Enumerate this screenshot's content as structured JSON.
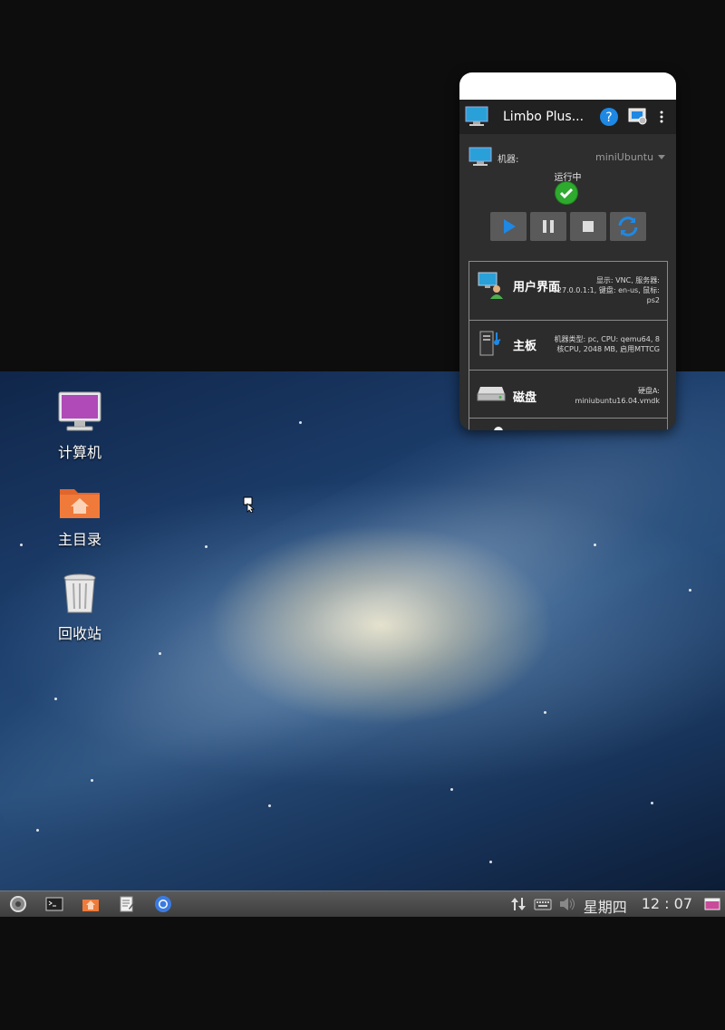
{
  "desktop": {
    "icons": [
      {
        "label": "计算机"
      },
      {
        "label": "主目录"
      },
      {
        "label": "回收站"
      }
    ]
  },
  "taskbar": {
    "weekday": "星期四",
    "time": "12 : 07"
  },
  "limbo": {
    "title": "Limbo Plus...",
    "machine_label": "机器:",
    "machine_value": "miniUbuntu",
    "status": "运行中",
    "cards": [
      {
        "title": "用户界面",
        "desc": "显示: VNC, 服务器: 127.0.0.1:1, 键盘: en-us, 鼠标: ps2"
      },
      {
        "title": "主板",
        "desc": "机器类型: pc, CPU: qemu64, 8 核CPU, 2048 MB, 启用MTTCG"
      },
      {
        "title": "磁盘",
        "desc": "硬盘A: miniubuntu16.04.vmdk"
      }
    ]
  },
  "colors": {
    "accent": "#1e88e5",
    "status_ok": "#2eaa2e"
  }
}
